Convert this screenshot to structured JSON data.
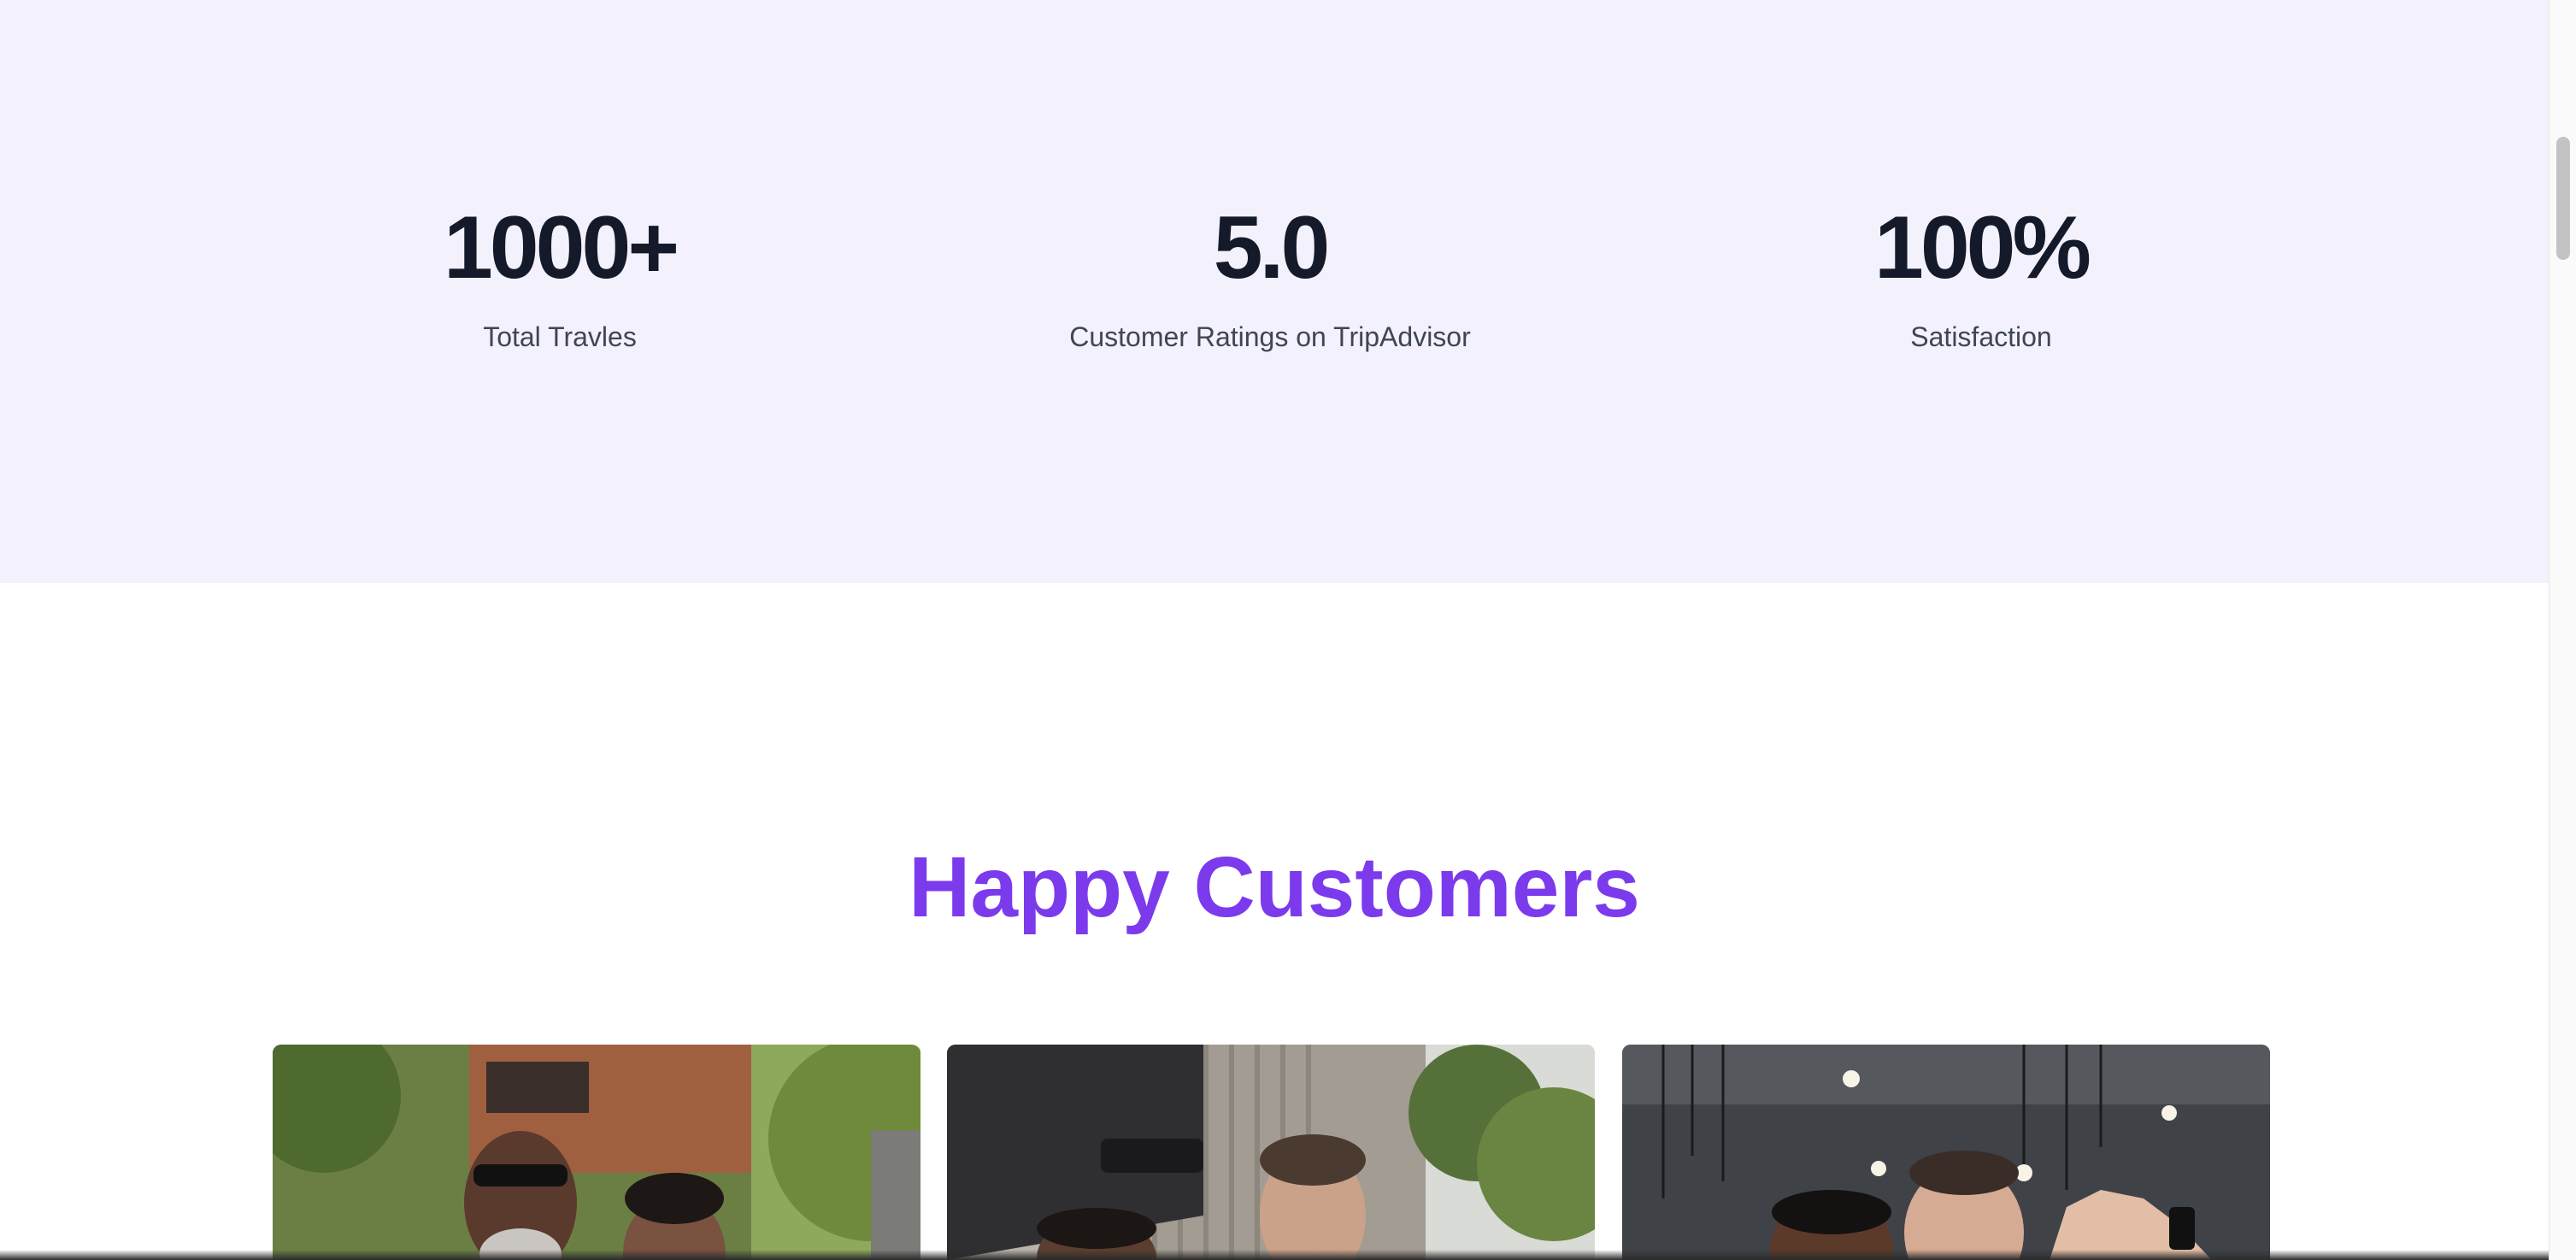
{
  "stats": [
    {
      "value": "1000+",
      "label": "Total Travles"
    },
    {
      "value": "5.0",
      "label": "Customer Ratings on TripAdvisor"
    },
    {
      "value": "100%",
      "label": "Satisfaction"
    }
  ],
  "customers": {
    "heading": "Happy Customers",
    "heading_color": "#7c3aed"
  }
}
